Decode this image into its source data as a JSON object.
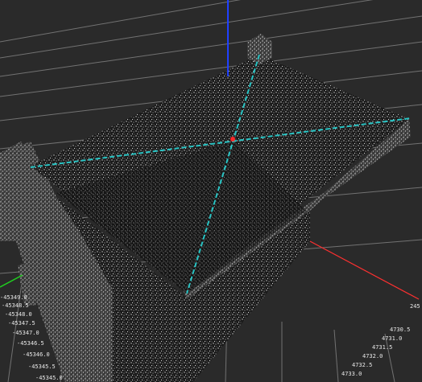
{
  "viewer": {
    "background_color": "#2a2a2a",
    "grid_color": "#8a8a8a",
    "point_cloud_color": "#bdbdbd",
    "axis_colors": {
      "x": "#ff3030",
      "y": "#20d020",
      "z": "#2040ff"
    },
    "measure_color": "#29c4c4",
    "center_marker_color": "#ff2a2a"
  },
  "axes": {
    "y_ticks": [
      "-45349.0",
      "-45348.5",
      "-45348.0",
      "-45347.5",
      "-45347.0",
      "-45346.5",
      "-45346.0",
      "-45345.5",
      "-45345.0"
    ],
    "x_ticks": [
      "4730.5",
      "4731.0",
      "4731.5",
      "4732.0",
      "4732.5",
      "4733.0"
    ],
    "z_tick": "245"
  }
}
